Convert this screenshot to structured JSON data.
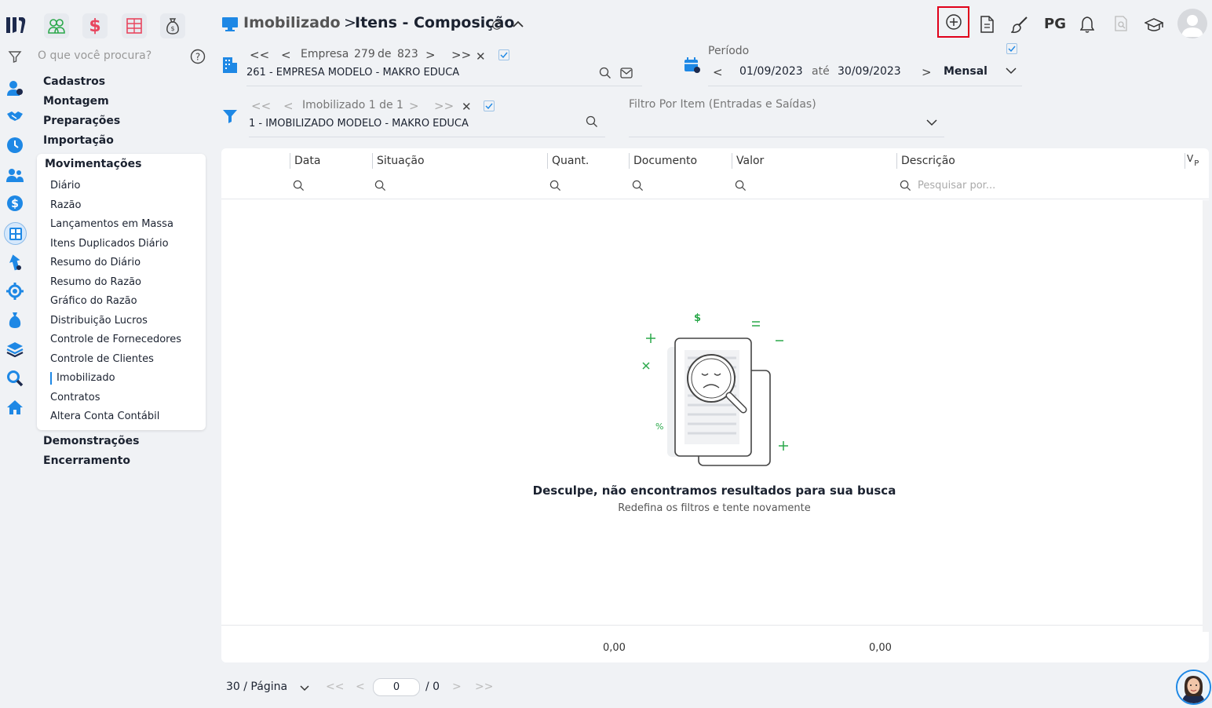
{
  "header": {
    "module": "Imobilizado",
    "separator": ">",
    "page": "Itens - Composição",
    "right_label": "PG"
  },
  "search": {
    "placeholder": "O que você procura?"
  },
  "company_nav": {
    "label": "Empresa",
    "current": "279",
    "of": "de",
    "total": "823",
    "value": "261 - EMPRESA MODELO - MAKRO EDUCA"
  },
  "period": {
    "label": "Período",
    "start": "01/09/2023",
    "between": "até",
    "end": "30/09/2023",
    "mode": "Mensal"
  },
  "asset_nav": {
    "label": "Imobilizado 1 de 1",
    "value": "1 - IMOBILIZADO MODELO - MAKRO EDUCA"
  },
  "item_filter": {
    "label": "Filtro Por Item (Entradas e Saídas)"
  },
  "sidebar": {
    "top_items": [
      "Cadastros",
      "Montagem",
      "Preparações",
      "Importação"
    ],
    "group_title": "Movimentações",
    "sub_items": [
      "Diário",
      "Razão",
      "Lançamentos em Massa",
      "Itens Duplicados Diário",
      "Resumo do Diário",
      "Resumo do Razão",
      "Gráfico do Razão",
      "Distribuição Lucros",
      "Controle de Fornecedores",
      "Controle de Clientes",
      "Imobilizado",
      "Contratos",
      "Altera Conta Contábil"
    ],
    "active_sub": "Imobilizado",
    "bottom_items": [
      "Demonstrações",
      "Encerramento"
    ]
  },
  "grid": {
    "columns": [
      "Data",
      "Situação",
      "Quant.",
      "Documento",
      "Valor",
      "Descrição"
    ],
    "vp_label_v": "V",
    "vp_label_p": "P",
    "search_placeholder": "Pesquisar por...",
    "empty_title": "Desculpe, não encontramos resultados para sua busca",
    "empty_subtitle": "Redefina os filtros e tente novamente",
    "total_quant": "0,00",
    "total_valor": "0,00"
  },
  "pagination": {
    "per_page": "30 / Página",
    "page_value": "0",
    "page_total": "/ 0"
  },
  "colors": {
    "brand_dark": "#1d2a4d",
    "accent_blue": "#1e88e5",
    "highlight_red": "#e0001a",
    "green": "#2aa84a",
    "pink": "#e8455e"
  }
}
